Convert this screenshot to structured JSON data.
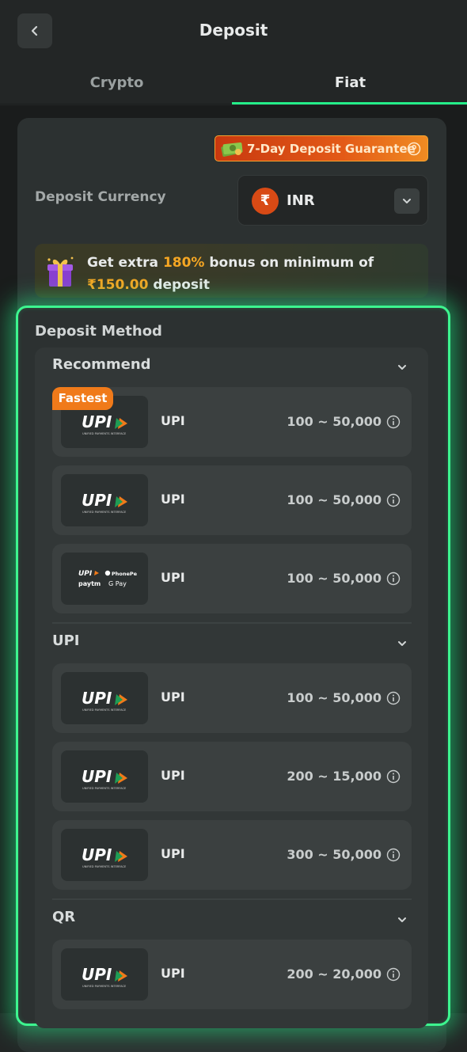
{
  "header": {
    "title": "Deposit"
  },
  "tabs": [
    {
      "label": "Crypto",
      "active": false
    },
    {
      "label": "Fiat",
      "active": true
    }
  ],
  "guarantee": {
    "label": "7-Day Deposit Guarantee"
  },
  "currency": {
    "label": "Deposit Currency",
    "code": "INR",
    "symbol": "₹"
  },
  "bonus": {
    "prefix": "Get extra ",
    "percent": "180%",
    "middle": " bonus on minimum of ",
    "amount": "₹150.00",
    "suffix": " deposit"
  },
  "deposit_method": {
    "title": "Deposit Method",
    "fastest_tag": "Fastest",
    "groups": [
      {
        "title": "Recommend",
        "items": [
          {
            "name": "UPI",
            "range": "100 ~ 50,000",
            "logo": "upi"
          },
          {
            "name": "UPI",
            "range": "100 ~ 50,000",
            "logo": "upi"
          },
          {
            "name": "UPI",
            "range": "100 ~ 50,000",
            "logo": "upi-multi"
          }
        ]
      },
      {
        "title": "UPI",
        "items": [
          {
            "name": "UPI",
            "range": "100 ~ 50,000",
            "logo": "upi"
          },
          {
            "name": "UPI",
            "range": "200 ~ 15,000",
            "logo": "upi"
          },
          {
            "name": "UPI",
            "range": "300 ~ 50,000",
            "logo": "upi"
          }
        ]
      },
      {
        "title": "QR",
        "items": [
          {
            "name": "UPI",
            "range": "200 ~ 20,000",
            "logo": "upi"
          }
        ]
      }
    ]
  },
  "logo_text": {
    "upi": "UPI",
    "upi_sub": "UNIFIED PAYMENTS INTERFACE",
    "phonepe": "PhonePe",
    "paytm": "paytm",
    "gpay": "G Pay"
  },
  "colors": {
    "accent": "#24ee89",
    "orange": "#f07a1a",
    "highlight": "#f5a623"
  }
}
